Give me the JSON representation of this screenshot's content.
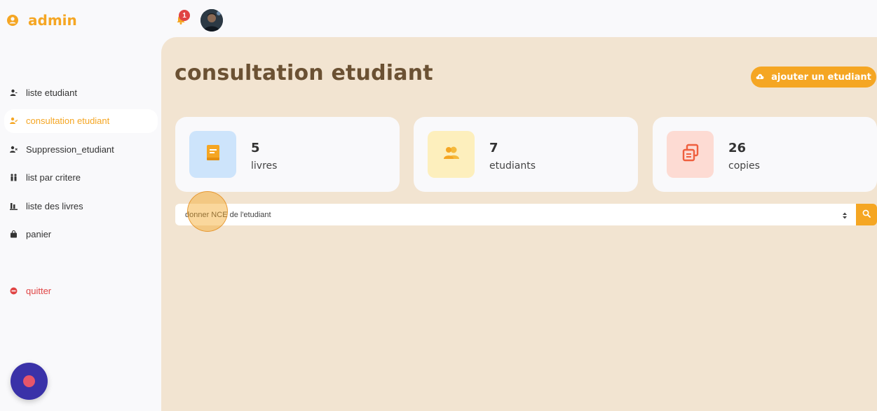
{
  "brand": {
    "title": "admin"
  },
  "sidebar": {
    "items": [
      {
        "label": "liste etudiant",
        "icon": "user-list-icon"
      },
      {
        "label": "consultation etudiant",
        "icon": "user-check-icon",
        "active": true
      },
      {
        "label": "Suppression_etudiant",
        "icon": "user-remove-icon"
      },
      {
        "label": "list par critere",
        "icon": "people-icon"
      },
      {
        "label": "liste des livres",
        "icon": "bar-chart-icon"
      },
      {
        "label": "panier",
        "icon": "shopping-bag-icon"
      },
      {
        "label": "quitter",
        "icon": "stop-icon"
      }
    ]
  },
  "topbar": {
    "notification_count": "1"
  },
  "main": {
    "title": "consultation etudiant",
    "add_button_label": "ajouter un etudiant",
    "cards": [
      {
        "value": "5",
        "label": "livres",
        "icon": "book-icon"
      },
      {
        "value": "7",
        "label": "etudiants",
        "icon": "users-icon"
      },
      {
        "value": "26",
        "label": "copies",
        "icon": "copy-icon"
      }
    ],
    "search": {
      "placeholder": "donner NCE de l'etudiant"
    }
  },
  "colors": {
    "accent": "#f5a623",
    "title": "#6b5133",
    "main_bg": "#f2e4d1",
    "danger": "#e04444"
  }
}
